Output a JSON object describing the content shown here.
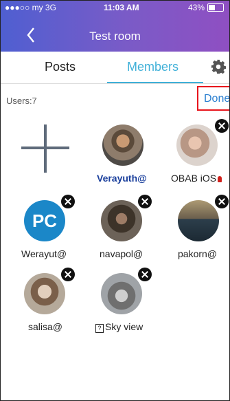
{
  "status": {
    "carrier": "●●●○○ my  3G",
    "time": "11:03 AM",
    "battery": "43%"
  },
  "nav": {
    "title": "Test room"
  },
  "tabs": [
    {
      "label": "Posts"
    },
    {
      "label": "Members"
    }
  ],
  "toolbar": {
    "users_label": "Users:7",
    "done_label": "Done"
  },
  "members": [
    {
      "name": "Verayuth@"
    },
    {
      "name": "OBAB iOS"
    },
    {
      "name": "Werayut@",
      "avatar_text": "PC"
    },
    {
      "name": "navapol@"
    },
    {
      "name": "pakorn@"
    },
    {
      "name": "salisa@"
    },
    {
      "name": "Sky view",
      "prefix_glyph": "?"
    }
  ],
  "colors": {
    "accent": "#3fb0d8",
    "header_start": "#4f5fd1",
    "header_end": "#8f4fc2",
    "done_border": "#e8141c",
    "selected_name": "#1a3f9c"
  }
}
